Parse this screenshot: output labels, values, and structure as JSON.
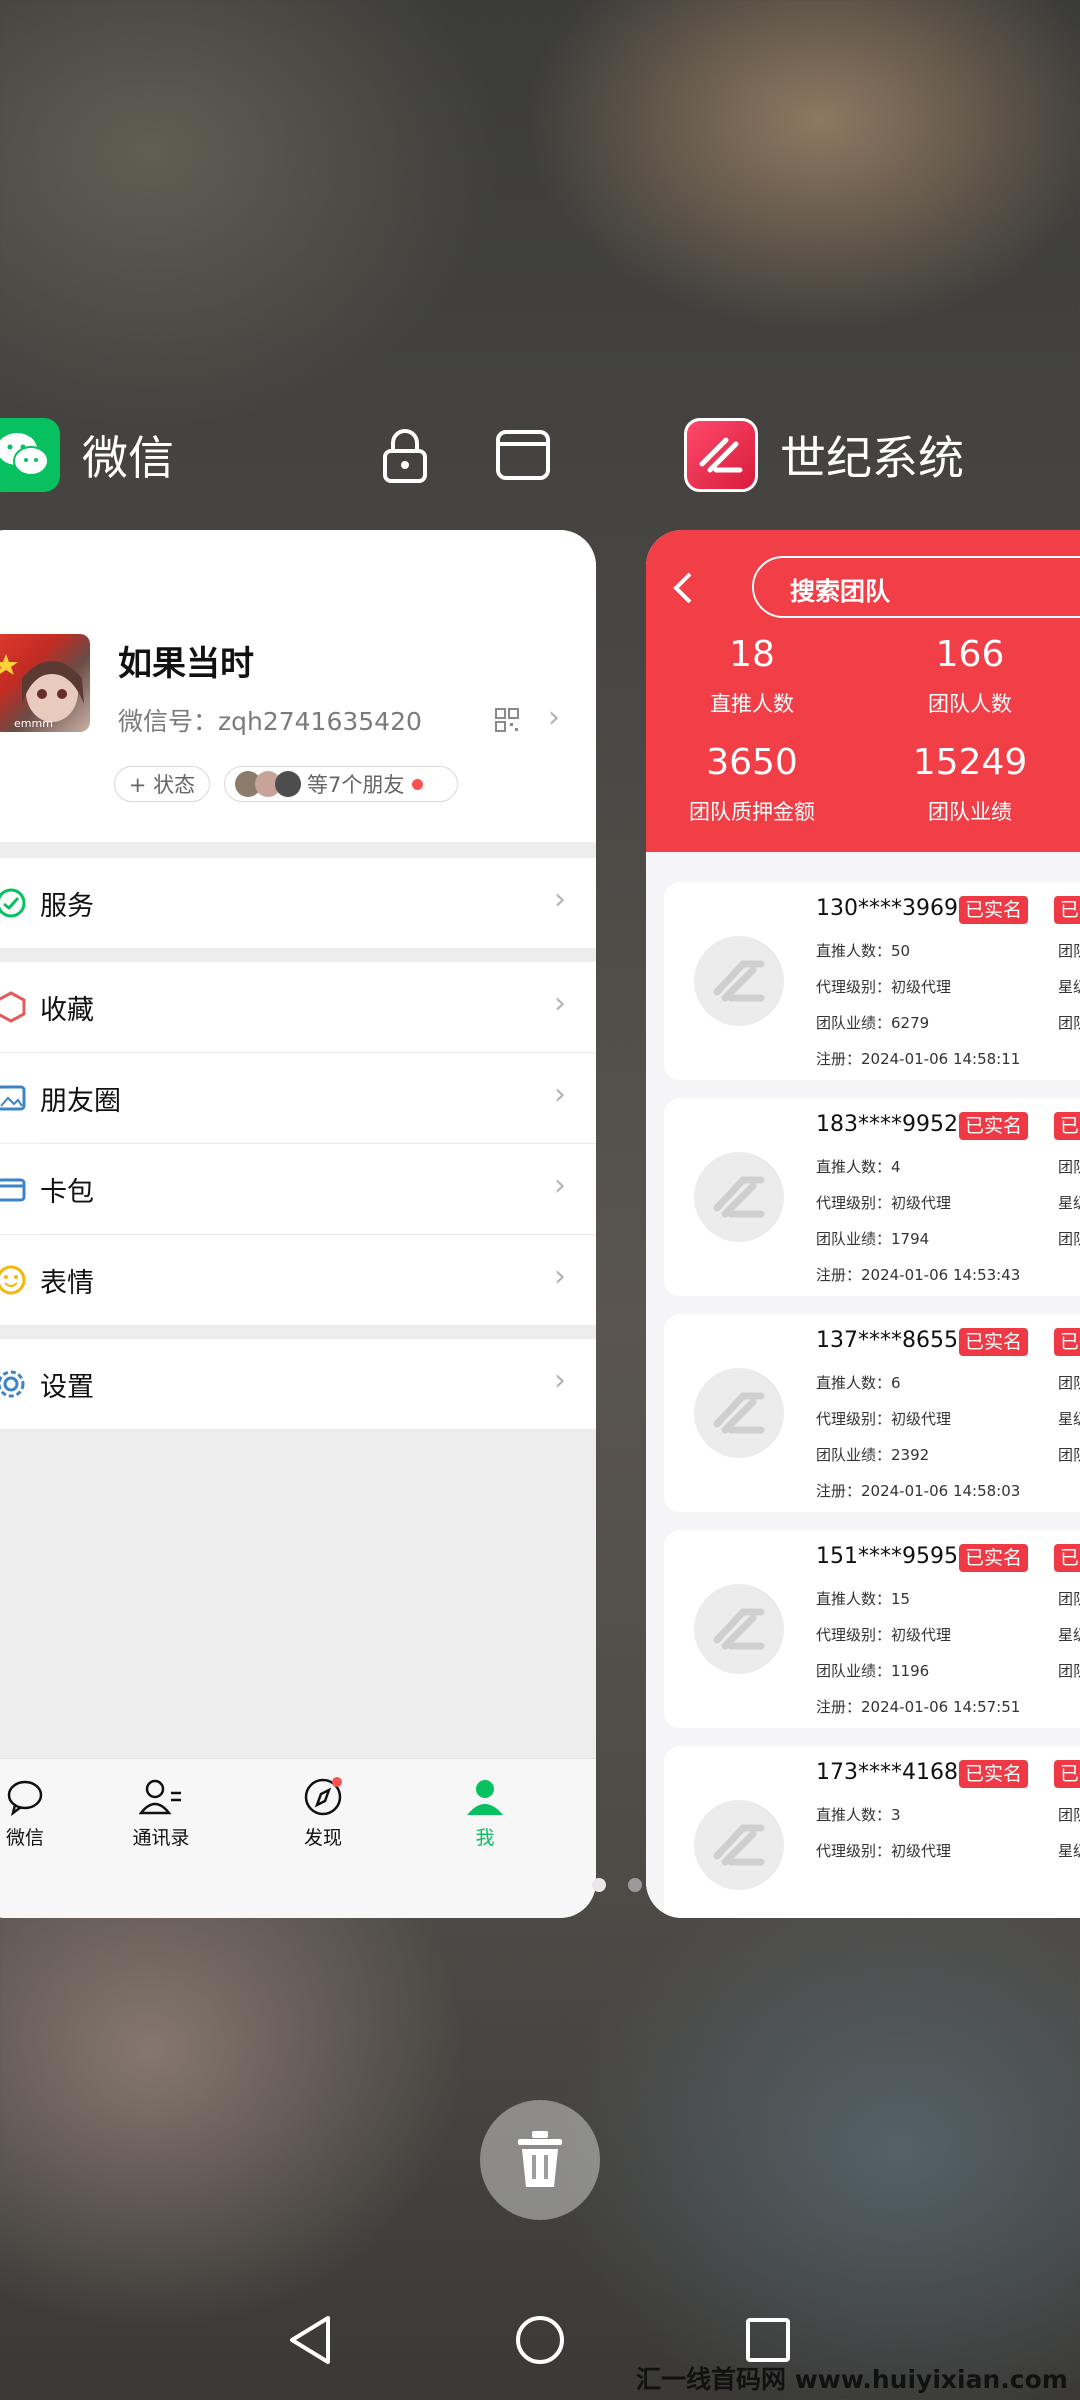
{
  "recents": {
    "wechat_app_name": "微信",
    "other_app_name": "世纪系统"
  },
  "wechat": {
    "profile": {
      "name": "如果当时",
      "wechat_id": "微信号：zqh2741635420",
      "status_button": "+ 状态",
      "friends_text": "等7个朋友",
      "avatar_caption": "emmm"
    },
    "menu": {
      "services": "服务",
      "favorites": "收藏",
      "moments": "朋友圈",
      "cards": "卡包",
      "stickers": "表情",
      "settings": "设置"
    },
    "tabs": {
      "chats": "微信",
      "contacts": "通讯录",
      "discover": "发现",
      "me": "我"
    },
    "colors": {
      "accent": "#07c160"
    }
  },
  "team": {
    "search_label": "搜索团队",
    "stats": [
      {
        "value": "18",
        "label": "直推人数"
      },
      {
        "value": "166",
        "label": "团队人数"
      },
      {
        "value": "3650",
        "label": "团队质押金额"
      },
      {
        "value": "15249",
        "label": "团队业绩"
      }
    ],
    "members": [
      {
        "phone": "130****3969",
        "badge1": "已实名",
        "badge2": "已签",
        "direct": "直推人数：50",
        "level": "代理级别：初级代理",
        "perf": "团队业绩：6279",
        "reg": "注册：2024-01-06 14:58:11",
        "r1": "团队人",
        "r2": "星级级",
        "r3": "团队质"
      },
      {
        "phone": "183****9952",
        "badge1": "已实名",
        "badge2": "已签",
        "direct": "直推人数：4",
        "level": "代理级别：初级代理",
        "perf": "团队业绩：1794",
        "reg": "注册：2024-01-06 14:53:43",
        "r1": "团队人",
        "r2": "星级级",
        "r3": "团队质"
      },
      {
        "phone": "137****8655",
        "badge1": "已实名",
        "badge2": "已签",
        "direct": "直推人数：6",
        "level": "代理级别：初级代理",
        "perf": "团队业绩：2392",
        "reg": "注册：2024-01-06 14:58:03",
        "r1": "团队人",
        "r2": "星级级",
        "r3": "团队质"
      },
      {
        "phone": "151****9595",
        "badge1": "已实名",
        "badge2": "已质",
        "direct": "直推人数：15",
        "level": "代理级别：初级代理",
        "perf": "团队业绩：1196",
        "reg": "注册：2024-01-06 14:57:51",
        "r1": "团队人",
        "r2": "星级级",
        "r3": "团队质"
      },
      {
        "phone": "173****4168",
        "badge1": "已实名",
        "badge2": "已签",
        "direct": "直推人数：3",
        "level": "代理级别：初级代理",
        "perf": "",
        "reg": "",
        "r1": "团队人",
        "r2": "星级级",
        "r3": ""
      }
    ],
    "colors": {
      "brand": "#f23e47"
    }
  },
  "watermark": "汇一线首码网 www.huiyixian.com"
}
